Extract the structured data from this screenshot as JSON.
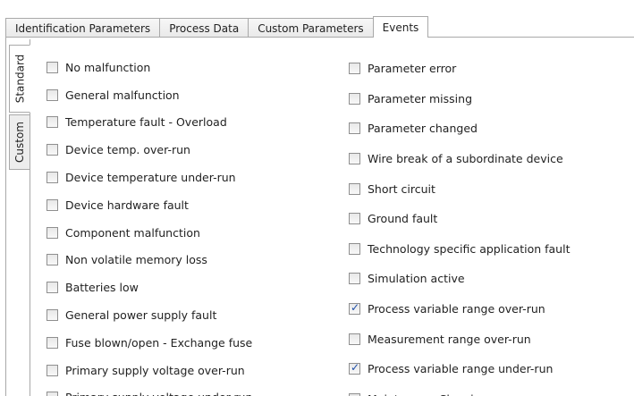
{
  "top_tabs": [
    {
      "label": "Identification Parameters",
      "active": false
    },
    {
      "label": "Process Data",
      "active": false
    },
    {
      "label": "Custom Parameters",
      "active": false
    },
    {
      "label": "Events",
      "active": true
    }
  ],
  "side_tabs": [
    {
      "label": "Standard",
      "active": true
    },
    {
      "label": "Custom",
      "active": false
    }
  ],
  "events_left": [
    {
      "label": "No malfunction",
      "checked": false
    },
    {
      "label": "General malfunction",
      "checked": false
    },
    {
      "label": "Temperature fault - Overload",
      "checked": false
    },
    {
      "label": "Device temp. over-run",
      "checked": false
    },
    {
      "label": "Device temperature under-run",
      "checked": false
    },
    {
      "label": "Device hardware fault",
      "checked": false
    },
    {
      "label": "Component malfunction",
      "checked": false
    },
    {
      "label": "Non volatile memory loss",
      "checked": false
    },
    {
      "label": "Batteries low",
      "checked": false
    },
    {
      "label": "General power supply fault",
      "checked": false
    },
    {
      "label": "Fuse blown/open - Exchange fuse",
      "checked": false
    },
    {
      "label": "Primary supply voltage over-run",
      "checked": false
    },
    {
      "label": "Primary supply voltage under-run",
      "checked": false
    }
  ],
  "events_right": [
    {
      "label": "Parameter error",
      "checked": false
    },
    {
      "label": "Parameter missing",
      "checked": false
    },
    {
      "label": "Parameter changed",
      "checked": false
    },
    {
      "label": "Wire break of a subordinate device",
      "checked": false
    },
    {
      "label": "Short circuit",
      "checked": false
    },
    {
      "label": "Ground fault",
      "checked": false
    },
    {
      "label": "Technology specific application fault",
      "checked": false
    },
    {
      "label": "Simulation active",
      "checked": false
    },
    {
      "label": "Process variable range over-run",
      "checked": true
    },
    {
      "label": "Measurement range over-run",
      "checked": false
    },
    {
      "label": "Process variable range under-run",
      "checked": true
    },
    {
      "label": "Maint. req. - Cleaning",
      "checked": false
    }
  ]
}
